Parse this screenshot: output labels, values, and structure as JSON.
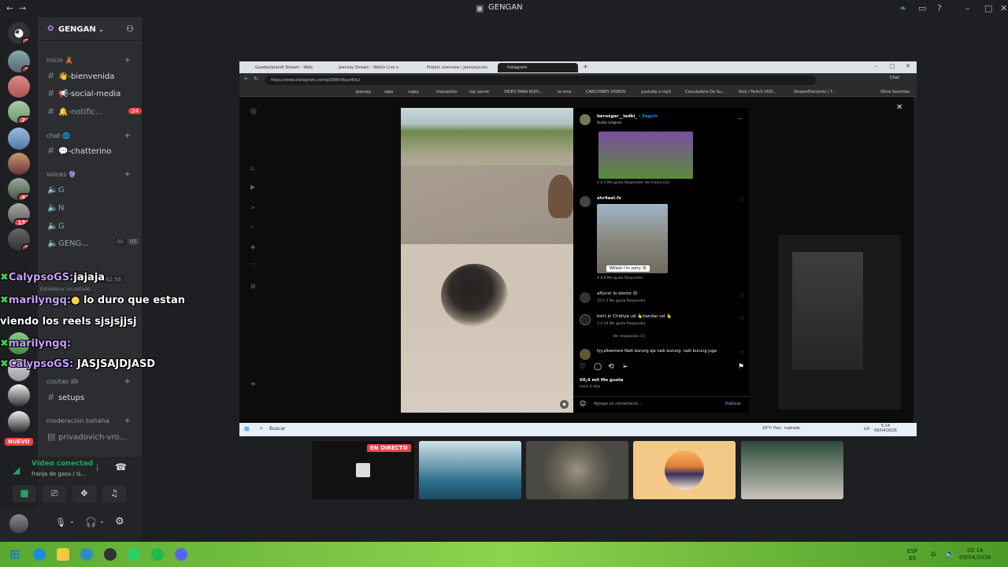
{
  "app": {
    "title": "GENGAN"
  },
  "rail": {
    "badges": [
      "3",
      "1",
      "24",
      "44",
      "134",
      "8"
    ],
    "nuevo": "NUEVO"
  },
  "sidebar": {
    "server": "GENGAN",
    "cats": {
      "inicio": "inicio 🧸",
      "chat": "chat 🌐",
      "voices": "voices 🔮",
      "cositas": "cositas 🎟",
      "moderacion": "moderacion bahaha"
    },
    "channels": {
      "bienvenida": "👋-bienvenida",
      "social": "📢-social-media",
      "notif": "🔔-notific...",
      "notif_count": "24",
      "chatterino": "💬-chatterino",
      "g1": "G",
      "n": "N",
      "g2": "G",
      "geng": "GENG...",
      "geng_a": "00",
      "geng_b": "05",
      "setups": "setups",
      "priv": "privadovich-vro..."
    },
    "stream_time": "4:42:58",
    "estado": "Establecer un estado ...",
    "voice_status": "Vídeo conectad",
    "voice_channel": "franja de gasa / G..."
  },
  "chat": [
    {
      "name": "CalypsoGS:",
      "msg": "jajaja"
    },
    {
      "name": "marilyngq:",
      "msg": "lo duro que estan"
    },
    {
      "name": "",
      "msg": "viendo los reels sjsjsjjsj"
    },
    {
      "name": "marilyngq:",
      "msg": ""
    },
    {
      "name": "CalypsoGS:",
      "msg": "JASJSAJDJASD"
    }
  ],
  "browser": {
    "tabs": [
      "GuadaLibrandi Stream - Watc",
      "jeensay Stream - Watch Live o",
      "Project overview | jeensayoutu",
      "Instagram"
    ],
    "url": "https://www.instagram.com/p/DWhVkjuo4Uu/",
    "chat_btn": "Chat",
    "bookmarks": [
      "jeensay",
      "rape",
      "rogey",
      "impuestito",
      "top secret",
      "VIDEO PARA KODI...",
      "te amo",
      "CANCIONES VIDEOS",
      "youtube a mp3",
      "Calculadora De Su...",
      "Kick / Twitch VOD...",
      "StreamElements | T...",
      "Otros favoritos"
    ]
  },
  "post": {
    "user": "berozgar__ladki_",
    "follow": "Seguir",
    "audio": "Audio original",
    "c1_meta": "2 d   2 Me gusta   Responder   Ver traducción",
    "c2_user": "shr4ael.fx",
    "c2_caption": "Wilson I'm sorry 😢",
    "c2_meta": "4 d   8 Me gusta   Responder",
    "c3": "alfynzr lo siento 😢",
    "c3_meta": "15 h   1 Me gusta   Responder",
    "c4": "ksht.jn Chidiya ud 👆bandar ud 👆",
    "c4_meta": "3 d   29 Me gusta   Responder",
    "c4_replies": "Ver respuestas (1)",
    "c5": "fyy.elleemere Naik burung aja naik burung. naik burung juga",
    "likes": "60,4 mil Me gusta",
    "ago": "Hace 4 días",
    "add_comment": "Agrega un comentario...",
    "publish": "Publicar"
  },
  "inner_taskbar": {
    "search": "Buscar",
    "weather": "18°C  Parc. nublado",
    "lang": "ESP",
    "time": "5:14",
    "date": "09/04/2026"
  },
  "cams": {
    "live": "EN DIRECTO"
  },
  "taskbar": {
    "lang1": "ESP",
    "lang2": "ES",
    "time": "05:14",
    "date": "09/04/2026"
  },
  "colors": {
    "accent": "#5865f2",
    "danger": "#f23f43",
    "green": "#23a55a"
  }
}
